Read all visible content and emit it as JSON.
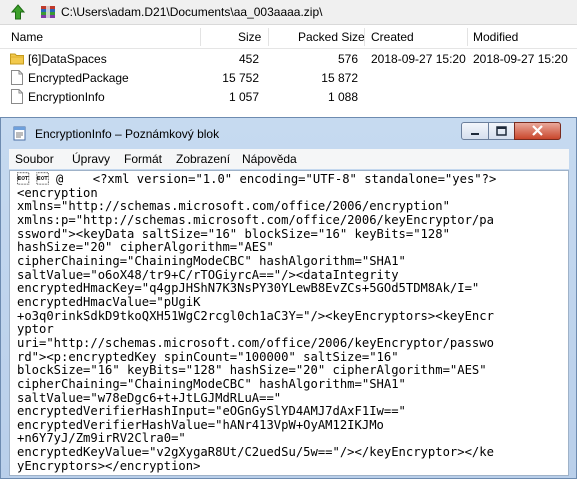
{
  "archive": {
    "path": "C:\\Users\\adam.D21\\Documents\\aa_003aaaa.zip\\",
    "columns": [
      "Name",
      "Size",
      "Packed Size",
      "Created",
      "Modified"
    ],
    "rows": [
      {
        "name": "[6]DataSpaces",
        "size": "452",
        "packed": "576",
        "created": "2018-09-27 15:20",
        "modified": "2018-09-27 15:20",
        "icon": "folder-icon"
      },
      {
        "name": "EncryptedPackage",
        "size": "15 752",
        "packed": "15 872",
        "created": "",
        "modified": "",
        "icon": "file-icon"
      },
      {
        "name": "EncryptionInfo",
        "size": "1 057",
        "packed": "1 088",
        "created": "",
        "modified": "",
        "icon": "file-icon"
      }
    ]
  },
  "notepad": {
    "title": "EncryptionInfo – Poznámkový blok",
    "menu": [
      "Soubor",
      "Úpravy",
      "Formát",
      "Zobrazení",
      "Nápověda"
    ],
    "content": "\u0004 \u0004 @    <?xml version=\"1.0\" encoding=\"UTF-8\" standalone=\"yes\"?>\n<encryption\nxmlns=\"http://schemas.microsoft.com/office/2006/encryption\"\nxmlns:p=\"http://schemas.microsoft.com/office/2006/keyEncryptor/pa\nssword\"><keyData saltSize=\"16\" blockSize=\"16\" keyBits=\"128\"\nhashSize=\"20\" cipherAlgorithm=\"AES\"\ncipherChaining=\"ChainingModeCBC\" hashAlgorithm=\"SHA1\"\nsaltValue=\"o6oX48/tr9+C/rTOGiyrcA==\"/><dataIntegrity\nencryptedHmacKey=\"q4gpJHShN7K3NsPY30YLewB8EvZCs+5GOd5TDM8Ak/I=\"\nencryptedHmacValue=\"pUgiK\n+o3q0rinkSdkD9tkoQXH51WgC2rcgl0ch1aC3Y=\"/><keyEncryptors><keyEncr\nyptor\nuri=\"http://schemas.microsoft.com/office/2006/keyEncryptor/passwo\nrd\"><p:encryptedKey spinCount=\"100000\" saltSize=\"16\"\nblockSize=\"16\" keyBits=\"128\" hashSize=\"20\" cipherAlgorithm=\"AES\"\ncipherChaining=\"ChainingModeCBC\" hashAlgorithm=\"SHA1\"\nsaltValue=\"w78eDgc6+t+JtLGJMdRLuA==\"\nencryptedVerifierHashInput=\"eOGnGySlYD4AMJ7dAxF1Iw==\"\nencryptedVerifierHashValue=\"hANr413VpW+OyAM12IKJMo\n+n6Y7yJ/Zm9irRV2Clra0=\"\nencryptedKeyValue=\"v2gXygaR8Ut/C2uedSu/5w==\"/></keyEncryptor></ke\nyEncryptors></encryption>"
  }
}
